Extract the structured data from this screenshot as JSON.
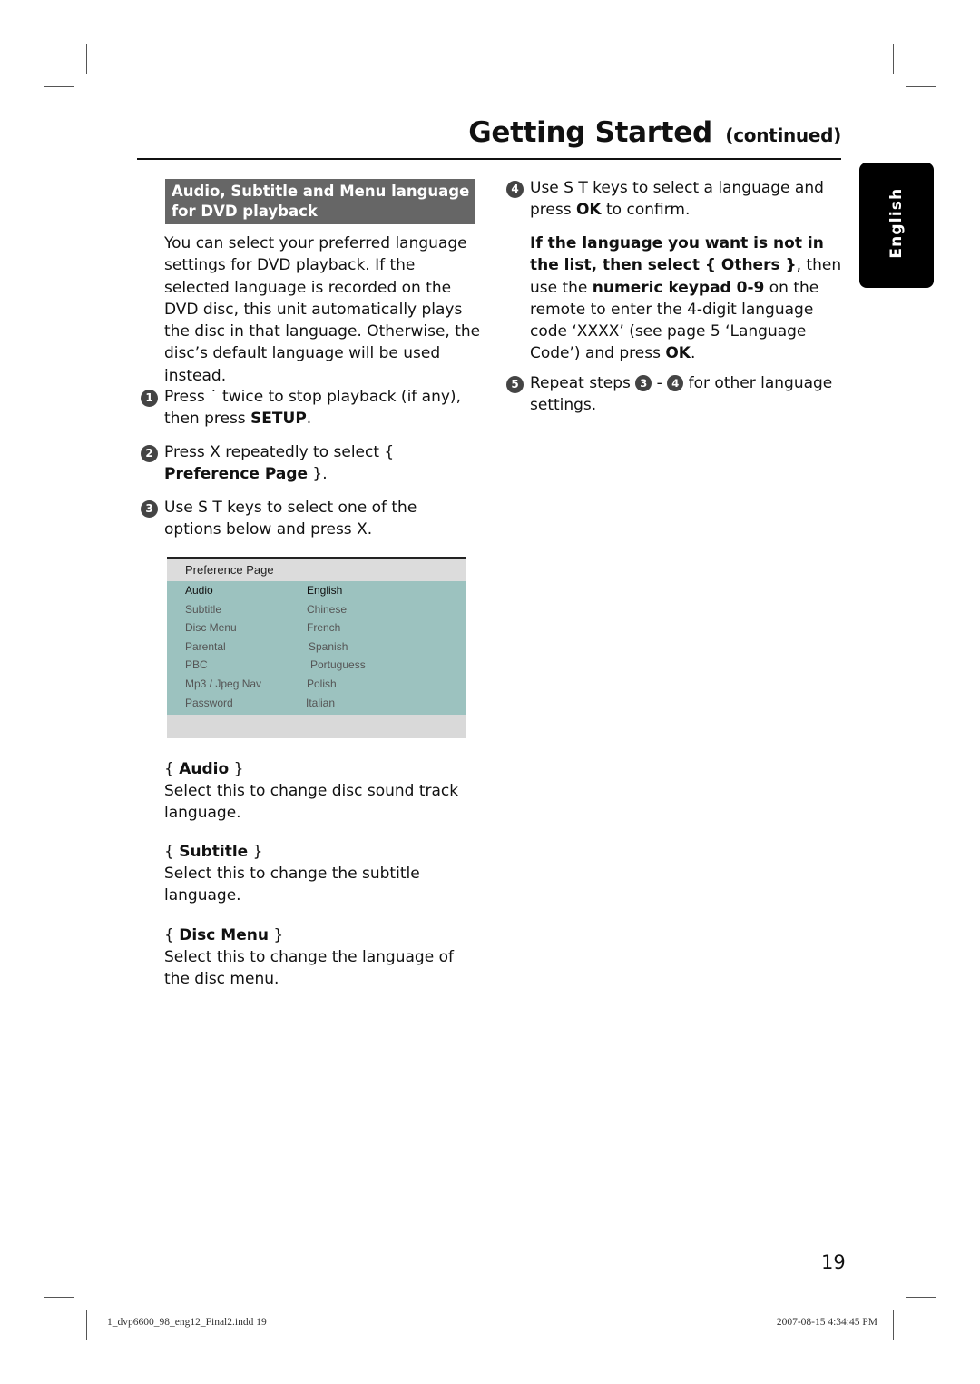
{
  "header": {
    "title": "Getting Started",
    "title_suffix": "(continued)"
  },
  "language_tab": "English",
  "section": {
    "heading": "Audio, Subtitle and Menu language for DVD playback",
    "intro": "You can select your preferred language settings for DVD playback. If the selected language is recorded on the DVD disc, this unit automatically plays the disc in that language. Otherwise, the disc’s default language will be used instead."
  },
  "steps": [
    {
      "num": "1",
      "parts": [
        "Press ˙   twice to stop playback (if any), then press ",
        "SETUP",
        "."
      ]
    },
    {
      "num": "2",
      "parts": [
        "Press  X repeatedly to select { ",
        "Preference Page",
        " }."
      ]
    },
    {
      "num": "3",
      "text": "Use  S T  keys to select one of the options below and press  X."
    },
    {
      "num": "4",
      "parts": [
        "Use  S T  keys to select a language and press ",
        "OK",
        " to confirm."
      ]
    },
    {
      "num": "5",
      "parts": [
        "Repeat steps ",
        "3",
        " - ",
        "4",
        " for other language settings."
      ]
    }
  ],
  "note": {
    "bold1": "If the language you want is not in the list, then select { Others }",
    "text1": ", then use the ",
    "bold2": "numeric keypad 0-9",
    "text2": " on the remote to enter the 4-digit language code ‘XXXX’ (see page 5 ‘Language Code’) and press ",
    "bold3": "OK",
    "text3": "."
  },
  "menu": {
    "title": "Preference Page",
    "rows": [
      {
        "label": "Audio",
        "value": "English",
        "selected": true
      },
      {
        "label": "Subtitle",
        "value": "Chinese"
      },
      {
        "label": "Disc Menu",
        "value": "French"
      },
      {
        "label": "Parental",
        "value": "Spanish"
      },
      {
        "label": "PBC",
        "value": "Portuguess"
      },
      {
        "label": "Mp3 / Jpeg Nav",
        "value": "Polish"
      },
      {
        "label": "Password",
        "value": "Italian"
      }
    ]
  },
  "options": [
    {
      "name": "Audio",
      "desc": "Select this to change disc sound track language."
    },
    {
      "name": "Subtitle",
      "desc": "Select this to change the subtitle language."
    },
    {
      "name": "Disc Menu",
      "desc": "Select this to change the language of the disc menu."
    }
  ],
  "page_number": "19",
  "footer": {
    "left": "1_dvp6600_98_eng12_Final2.indd   19",
    "right": "2007-08-15   4:34:45 PM"
  }
}
